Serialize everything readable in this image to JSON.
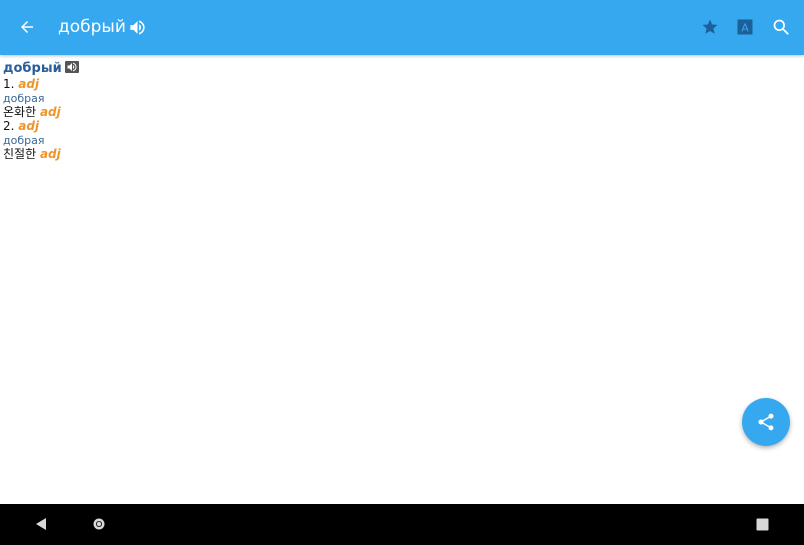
{
  "appbar": {
    "title": "добрый",
    "icons": [
      "back-arrow-icon",
      "speaker-icon",
      "star-icon",
      "translate-icon",
      "search-icon"
    ],
    "color": "#35a8f0"
  },
  "entry": {
    "headword": "добрый",
    "senses": [
      {
        "number": "1.",
        "pos": "adj",
        "form": "добрая",
        "translation": "온화한",
        "translation_pos": "adj"
      },
      {
        "number": "2.",
        "pos": "adj",
        "form": "добрая",
        "translation": "친절한",
        "translation_pos": "adj"
      }
    ],
    "headword_color": "#2a5d9b",
    "pos_color": "#f0952a"
  },
  "fab": {
    "icon": "share-icon"
  },
  "navbar": {
    "icons": [
      "nav-back-icon",
      "nav-home-icon",
      "nav-recents-icon"
    ]
  }
}
